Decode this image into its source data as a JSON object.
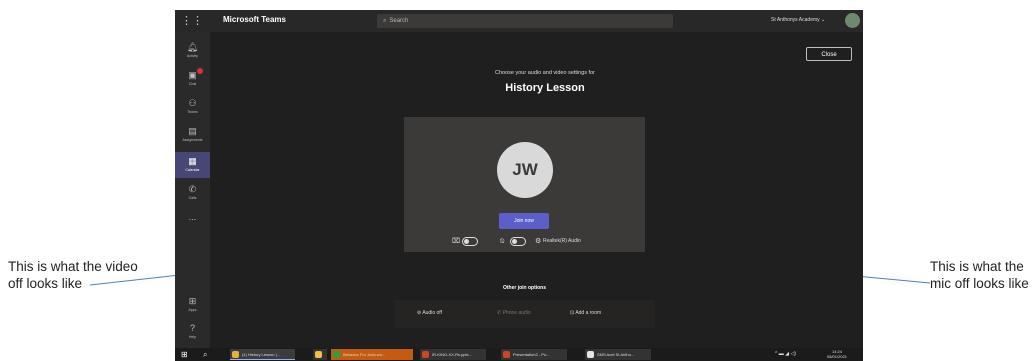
{
  "annotations": {
    "left": "This is what the video off looks like",
    "right": "This is what the mic off looks like"
  },
  "titlebar": {
    "app_title": "Microsoft Teams",
    "search_placeholder": "Search",
    "org": "St Anthonys Academy ⌄"
  },
  "rail": [
    {
      "label": "Activity",
      "icon": "bell-icon"
    },
    {
      "label": "Chat",
      "icon": "chat-icon"
    },
    {
      "label": "Teams",
      "icon": "teams-icon"
    },
    {
      "label": "Assignments",
      "icon": "assignments-icon"
    },
    {
      "label": "Calendar",
      "icon": "calendar-icon"
    },
    {
      "label": "Calls",
      "icon": "phone-icon"
    },
    {
      "label": "...",
      "icon": "more-icon"
    },
    {
      "label": "Apps",
      "icon": "apps-icon"
    },
    {
      "label": "Help",
      "icon": "help-icon"
    }
  ],
  "prejoin": {
    "close_label": "Close",
    "prompt": "Choose your audio and video settings for",
    "meeting_title": "History Lesson",
    "avatar_initials": "JW",
    "join_label": "Join now",
    "audio_device": "Realtek(R) Audio",
    "video_on": false,
    "mic_on": false
  },
  "other_join": {
    "title": "Other join options",
    "audio_off": "Audio off",
    "phone_audio": "Phone audio",
    "add_room": "Add a room"
  },
  "taskbar": {
    "items": [
      "(1) History Lesson |...",
      "",
      "Behavior For Judo.wo...",
      "IR-KING-XX-Rs.pptx...",
      "Presentation2 - Po...",
      "SMS Acet St Antho..."
    ],
    "time": "14:24",
    "date": "08/01/2021"
  },
  "colors": {
    "accent": "#5b5fc7",
    "rail_active": "#464775",
    "window_bg": "#201f1f"
  }
}
